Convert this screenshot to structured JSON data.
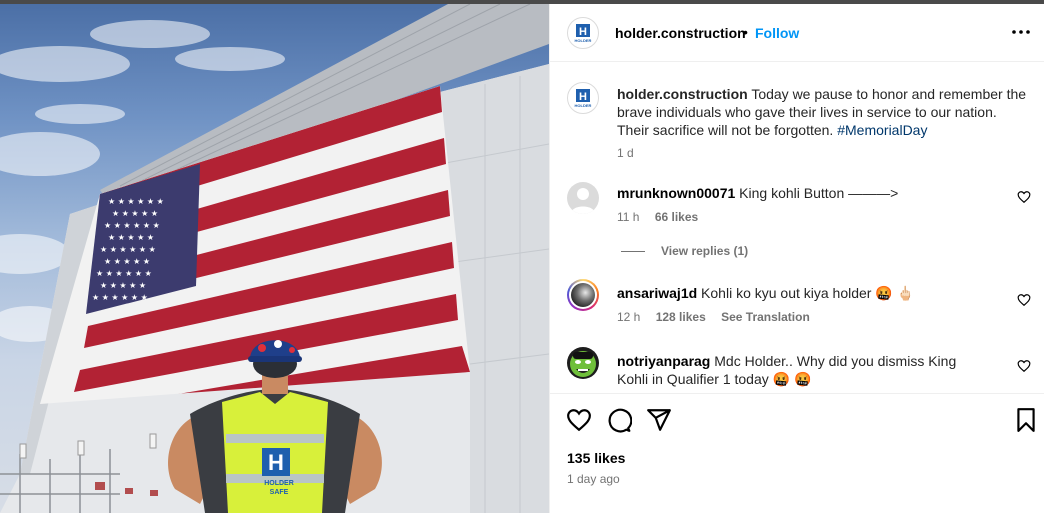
{
  "post": {
    "account": "holder.construction",
    "separator": "•",
    "follow_label": "Follow",
    "more_icon": "more-horizontal-icon",
    "logo_letter": "H",
    "logo_text": "HOLDER"
  },
  "caption": {
    "username": "holder.construction",
    "text": "Today we pause to honor and remember the brave individuals who gave their lives in service to our nation. Their sacrifice will not be forgotten.",
    "hashtag": "#MemorialDay",
    "time": "1 d"
  },
  "comments": [
    {
      "username": "mrunknown00071",
      "text": "King kohli Button ———>",
      "time": "11 h",
      "likes": "66 likes",
      "view_replies": "View replies (1)"
    },
    {
      "username": "ansariwaj1d",
      "text": "Kohli ko kyu out kiya holder 🤬 🖕🏻",
      "time": "12 h",
      "likes": "128 likes",
      "translation": "See Translation"
    },
    {
      "username": "notriyanparag",
      "text": "Mdc Holder.. Why did you dismiss King Kohli in Qualifier 1 today 🤬 🤬"
    }
  ],
  "footer": {
    "likes": "135 likes",
    "time": "1 day ago"
  },
  "photo": {
    "vest_logo_text": "HOLDER",
    "vest_sub_text": "SAFE"
  },
  "colors": {
    "follow": "#0095f6",
    "hashtag": "#00376b",
    "muted": "#737373",
    "flag_red": "#b22234",
    "flag_blue": "#3c3b6e",
    "vest": "#d8f03a"
  }
}
